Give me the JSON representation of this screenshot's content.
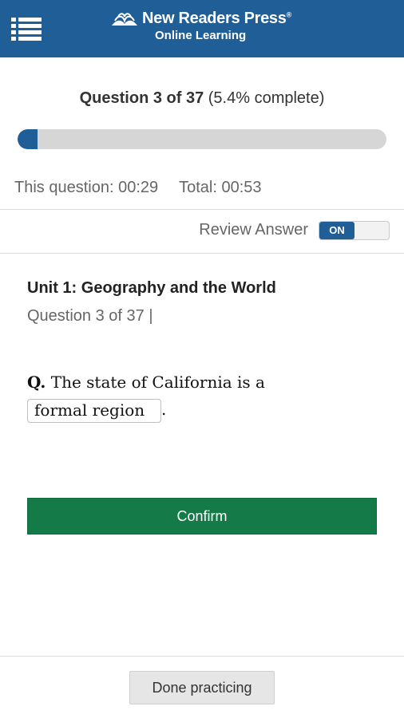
{
  "header": {
    "menu_icon": "list-menu-icon",
    "logo_icon": "book-leaves-icon",
    "brand_title": "New Readers Press",
    "brand_trademark": "®",
    "brand_subtitle": "Online Learning",
    "background": "#1f5e96"
  },
  "progress": {
    "label_strong": "Question 3 of 37",
    "label_detail": "(5.4% complete)",
    "fraction": 0.054,
    "fill_color": "#1f5e96",
    "question_timer": "This question: 00:29",
    "total_timer": "Total: 00:53"
  },
  "review": {
    "label": "Review Answer",
    "toggle_state": "ON"
  },
  "question": {
    "unit_title": "Unit 1: Geography and the World",
    "counter": "Question 3 of 37 |",
    "prefix": "Q.",
    "text": "The state of California is a",
    "answer": "formal region",
    "suffix": "."
  },
  "actions": {
    "confirm_label": "Confirm",
    "confirm_color": "#147a47",
    "done_label": "Done practicing"
  }
}
